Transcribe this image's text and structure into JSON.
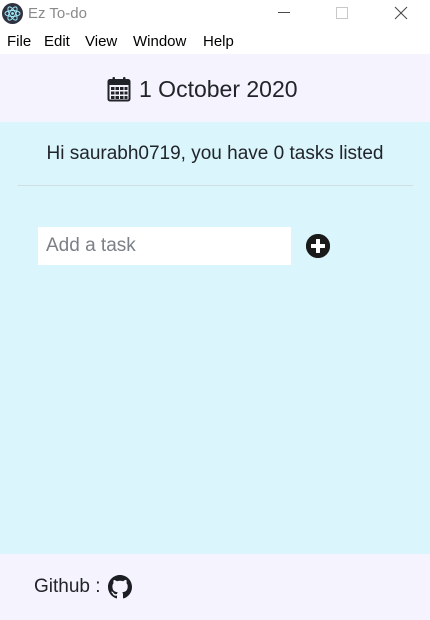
{
  "window": {
    "title": "Ez To-do",
    "icon": "electron-app-icon",
    "controls": [
      "minimize-icon",
      "maximize-icon",
      "close-icon"
    ]
  },
  "menu": {
    "file": "File",
    "edit": "Edit",
    "view": "View",
    "window": "Window",
    "help": "Help"
  },
  "header": {
    "icon": "calendar-icon",
    "date": "1 October 2020"
  },
  "main": {
    "greeting": "Hi saurabh0719, you have 0 tasks listed",
    "task_input": {
      "value": "",
      "placeholder": "Add a task"
    },
    "add_button_icon": "plus-circle-icon"
  },
  "footer": {
    "label": "Github :",
    "icon": "github-icon"
  },
  "colors": {
    "header_bg": "#f5f3fd",
    "main_bg": "#daf5fc",
    "footer_bg": "#f5f3fd",
    "text": "#212529"
  }
}
